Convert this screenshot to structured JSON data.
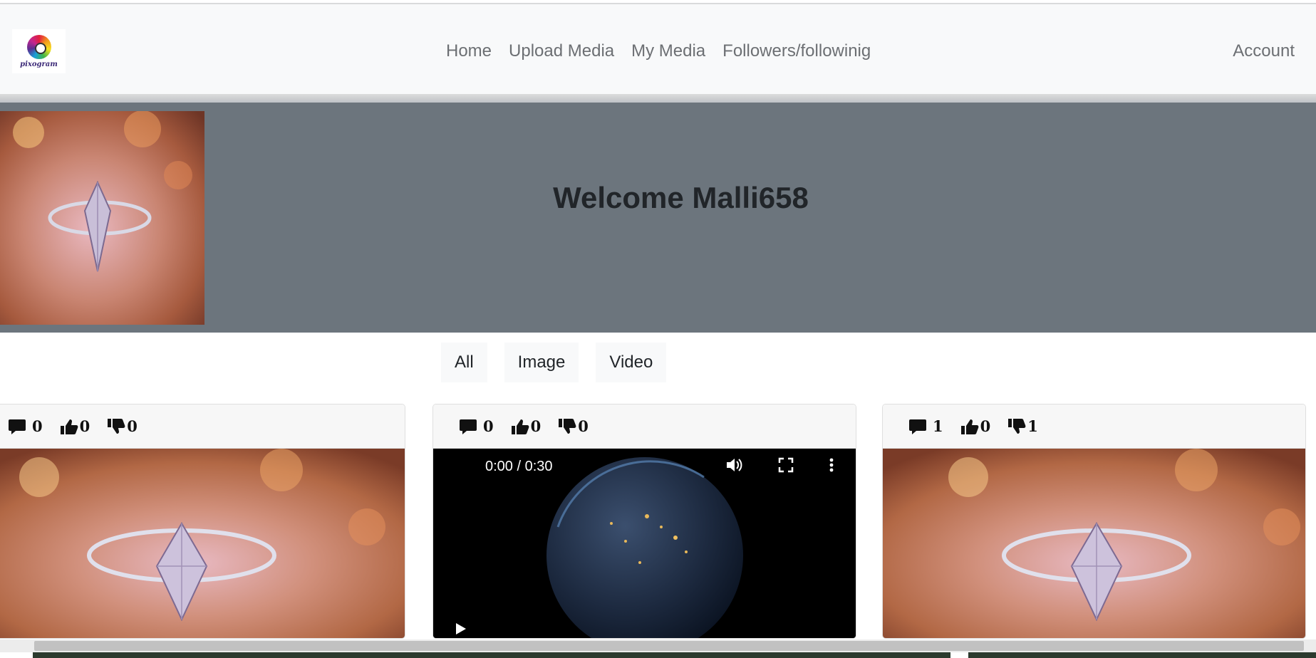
{
  "app": {
    "name": "pixogram"
  },
  "navbar": {
    "logo_text": "pixogram",
    "links": [
      "Home",
      "Upload Media",
      "My Media",
      "Followers/followinig"
    ],
    "account": "Account"
  },
  "hero": {
    "welcome": "Welcome Malli658"
  },
  "filters": [
    "All",
    "Image",
    "Video"
  ],
  "cards": [
    {
      "type": "image",
      "comments": "0",
      "likes": "0",
      "dislikes": "0"
    },
    {
      "type": "video",
      "comments": "0",
      "likes": "0",
      "dislikes": "0",
      "time": "0:00 / 0:30"
    },
    {
      "type": "image",
      "comments": "1",
      "likes": "0",
      "dislikes": "1"
    }
  ],
  "colors": {
    "navbar_bg": "#f8f9fa",
    "hero_bg": "#6c757d",
    "nav_text": "#6c6f73"
  }
}
